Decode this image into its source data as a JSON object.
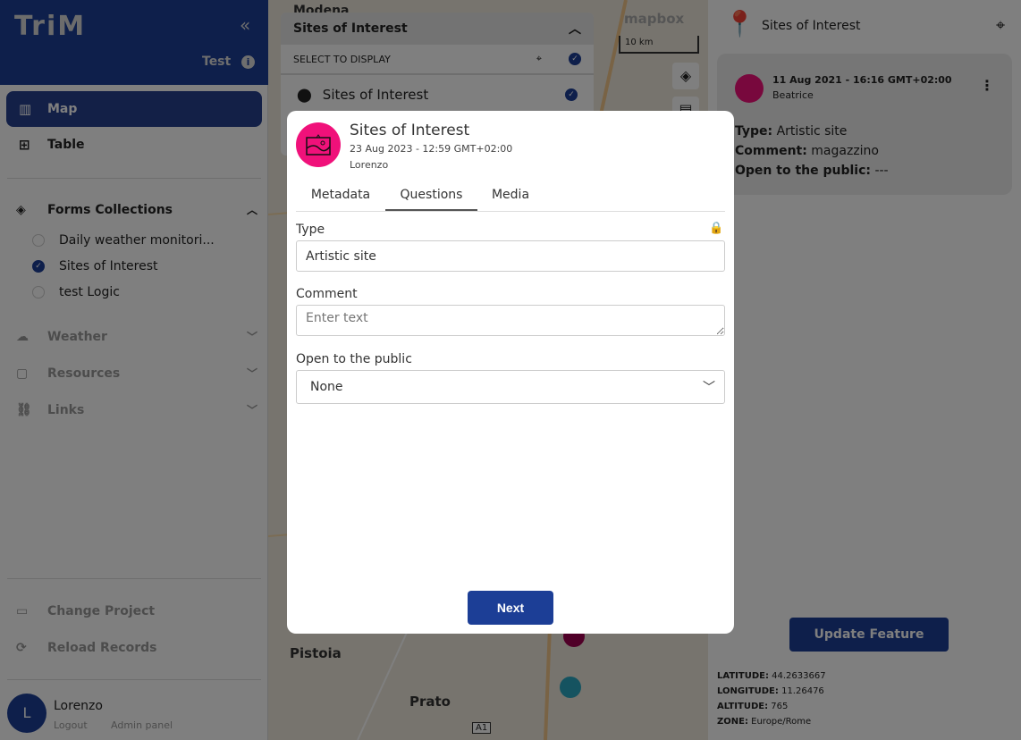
{
  "sidebar": {
    "logo": "TriM",
    "project": "Test",
    "nav": [
      {
        "label": "Map",
        "icon": "map-icon"
      },
      {
        "label": "Table",
        "icon": "table-icon"
      }
    ],
    "forms_title": "Forms Collections",
    "forms": [
      {
        "label": "Daily weather monitori...",
        "checked": false
      },
      {
        "label": "Sites of Interest",
        "checked": true
      },
      {
        "label": "test Logic",
        "checked": false
      }
    ],
    "sections": [
      "Weather",
      "Resources",
      "Links"
    ],
    "change_project": "Change Project",
    "reload": "Reload Records",
    "user": {
      "initial": "L",
      "name": "Lorenzo",
      "logout": "Logout",
      "admin": "Admin panel"
    }
  },
  "map": {
    "layer_panel": {
      "title": "Sites of Interest",
      "select_label": "SELECT TO DISPLAY",
      "layer": "Sites of Interest"
    },
    "scale": "10 km",
    "attribution": "mapbox",
    "places": [
      "Modena",
      "Pistoia",
      "Prato"
    ],
    "road": "A1"
  },
  "panel": {
    "title": "Sites of Interest",
    "card": {
      "date": "11 Aug 2021 - 16:16 GMT+02:00",
      "user": "Beatrice",
      "type_k": "Type:",
      "type_v": "Artistic site",
      "comment_k": "Comment:",
      "comment_v": "magazzino",
      "open_k": "Open to the public:",
      "open_v": "---"
    },
    "update": "Update Feature",
    "coords": [
      {
        "k": "LATITUDE:",
        "v": "44.2633667"
      },
      {
        "k": "LONGITUDE:",
        "v": "11.26476"
      },
      {
        "k": "ALTITUDE:",
        "v": "765"
      },
      {
        "k": "ZONE:",
        "v": "Europe/Rome"
      }
    ]
  },
  "modal": {
    "title": "Sites of Interest",
    "date": "23 Aug 2023 - 12:59 GMT+02:00",
    "user": "Lorenzo",
    "tabs": [
      "Metadata",
      "Questions",
      "Media"
    ],
    "type_label": "Type",
    "type_value": "Artistic site",
    "comment_label": "Comment",
    "comment_placeholder": "Enter text",
    "open_label": "Open to the public",
    "open_value": "None",
    "next": "Next"
  },
  "colors": {
    "primary": "#1c3e96",
    "accent": "#f0117a"
  }
}
